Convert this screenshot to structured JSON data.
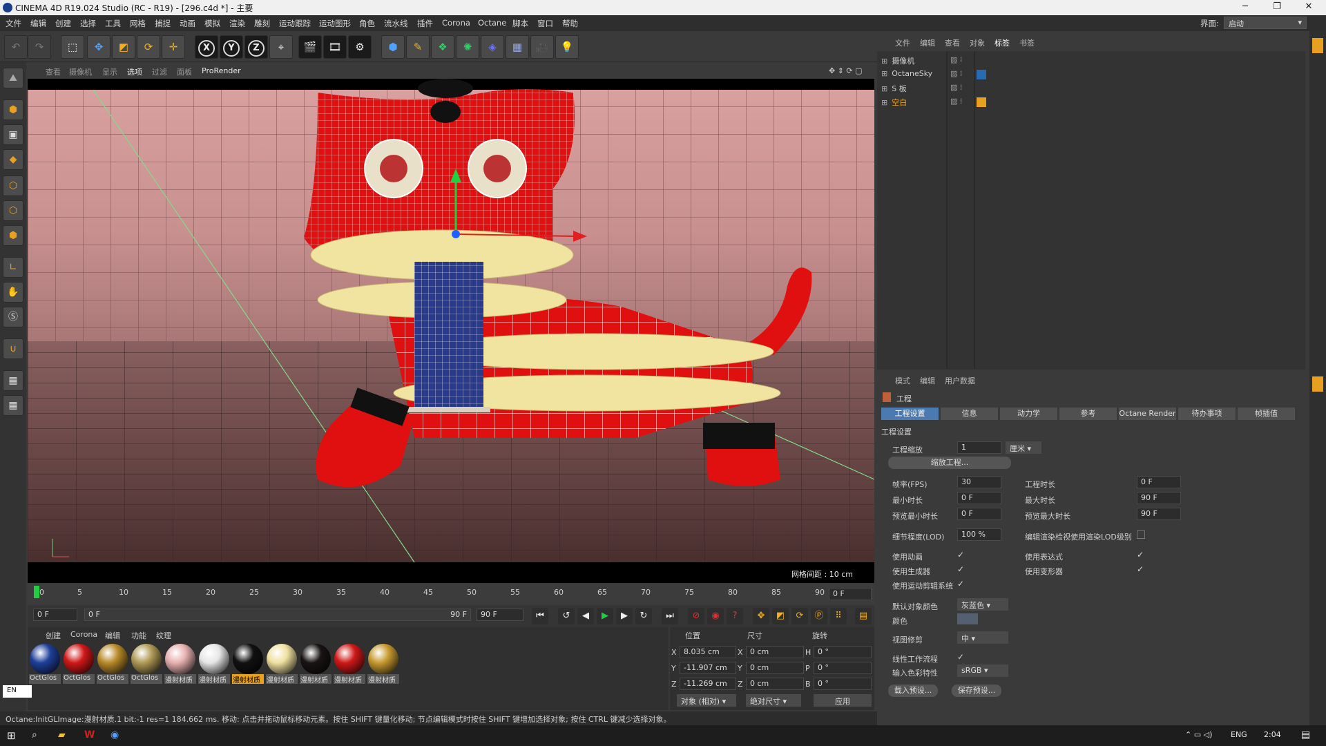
{
  "window": {
    "title": "CINEMA 4D R19.024 Studio (RC - R19) - [296.c4d *] - 主要"
  },
  "menu": [
    "文件",
    "编辑",
    "创建",
    "选择",
    "工具",
    "网格",
    "捕捉",
    "动画",
    "模拟",
    "渲染",
    "雕刻",
    "运动跟踪",
    "运动图形",
    "角色",
    "流水线",
    "插件",
    "Corona",
    "Octane",
    "脚本",
    "窗口",
    "帮助"
  ],
  "interface": {
    "label": "界面:",
    "value": "启动"
  },
  "viewport": {
    "menu": [
      "查看",
      "摄像机",
      "显示",
      "选项",
      "过滤",
      "面板",
      "ProRender"
    ],
    "grid_label": "网格间距 : 10 cm"
  },
  "timeline": {
    "ticks": [
      "0",
      "5",
      "10",
      "15",
      "20",
      "25",
      "30",
      "35",
      "40",
      "45",
      "50",
      "55",
      "60",
      "65",
      "70",
      "75",
      "80",
      "85",
      "90"
    ],
    "current": "0 F",
    "start": "0 F",
    "range_start": "0 F",
    "range_end": "90 F",
    "end": "90 F"
  },
  "materials": {
    "menu": [
      "创建",
      "Corona",
      "编辑",
      "功能",
      "纹理"
    ],
    "items": [
      {
        "label": "OctGlos",
        "color": "#1f3f9a"
      },
      {
        "label": "OctGlos",
        "color": "#d01818"
      },
      {
        "label": "OctGlos",
        "color": "#b98a2a"
      },
      {
        "label": "OctGlos",
        "color": "#b09a55"
      },
      {
        "label": "漫射材质",
        "color": "#e8b0b0"
      },
      {
        "label": "漫射材质",
        "color": "#e6e6e6"
      },
      {
        "label": "漫射材质",
        "color": "#111111"
      },
      {
        "label": "漫射材质",
        "color": "#f0e0a0"
      },
      {
        "label": "漫射材质",
        "color": "#1a1414"
      },
      {
        "label": "漫射材质",
        "color": "#d01818"
      },
      {
        "label": "漫射材质",
        "color": "#c79a30"
      }
    ]
  },
  "coords": {
    "headers": [
      "位置",
      "尺寸",
      "旋转"
    ],
    "rows": [
      {
        "axis": "X",
        "pos": "8.035 cm",
        "sizeaxis": "X",
        "size": "0 cm",
        "rotaxis": "H",
        "rot": "0 °"
      },
      {
        "axis": "Y",
        "pos": "-11.907 cm",
        "sizeaxis": "Y",
        "size": "0 cm",
        "rotaxis": "P",
        "rot": "0 °"
      },
      {
        "axis": "Z",
        "pos": "-11.269 cm",
        "sizeaxis": "Z",
        "size": "0 cm",
        "rotaxis": "B",
        "rot": "0 °"
      }
    ],
    "mode": "对象 (相对)",
    "sizemode": "绝对尺寸",
    "apply": "应用"
  },
  "status": "Octane:InitGLImage:漫射材质.1  bit:-1 res=1  184.662 ms.   移动: 点击并拖动鼠标移动元素。按住 SHIFT 键量化移动; 节点编辑模式时按住 SHIFT 键增加选择对象; 按住 CTRL 键减少选择对象。",
  "lang": "EN",
  "objects": {
    "menu": [
      "文件",
      "编辑",
      "查看",
      "对象",
      "标签",
      "书签"
    ],
    "rows": [
      {
        "name": "摄像机",
        "color": "#cfcfcf"
      },
      {
        "name": "OctaneSky",
        "color": "#cfcfcf"
      },
      {
        "name": "S 板",
        "color": "#cfcfcf"
      },
      {
        "name": "空白",
        "color": "#e8a020"
      }
    ]
  },
  "attributes": {
    "menu": [
      "模式",
      "编辑",
      "用户数据"
    ],
    "title": "工程",
    "tabs": [
      "工程设置",
      "信息",
      "动力学",
      "参考",
      "Octane Render",
      "待办事项",
      "帧插值"
    ],
    "section": "工程设置",
    "scale_label": "工程缩放",
    "scale_value": "1",
    "scale_unit": "厘米",
    "scale_btn": "缩放工程...",
    "fps_label": "帧率(FPS)",
    "fps": "30",
    "dur_label": "工程时长",
    "dur": "0 F",
    "min_label": "最小时长",
    "min": "0 F",
    "max_label": "最大时长",
    "max": "90 F",
    "pmin_label": "预览最小时长",
    "pmin": "0 F",
    "pmax_label": "预览最大时长",
    "pmax": "90 F",
    "lod_label": "细节程度(LOD)",
    "lod": "100 %",
    "lod2_label": "编辑渲染检视使用渲染LOD级别",
    "anim_label": "使用动画",
    "expr_label": "使用表达式",
    "gen_label": "使用生成器",
    "deform_label": "使用变形器",
    "mograph_label": "使用运动剪辑系统",
    "objcolor_label": "默认对象颜色",
    "objcolor": "灰蓝色",
    "color_label": "颜色",
    "vclip_label": "视图修剪",
    "vclip": "中",
    "linear_label": "线性工作流程",
    "input_label": "输入色彩特性",
    "input": "sRGB",
    "load_btn": "载入预设...",
    "save_btn": "保存预设..."
  },
  "taskbar": {
    "lang": "ENG",
    "time": "2:04"
  }
}
